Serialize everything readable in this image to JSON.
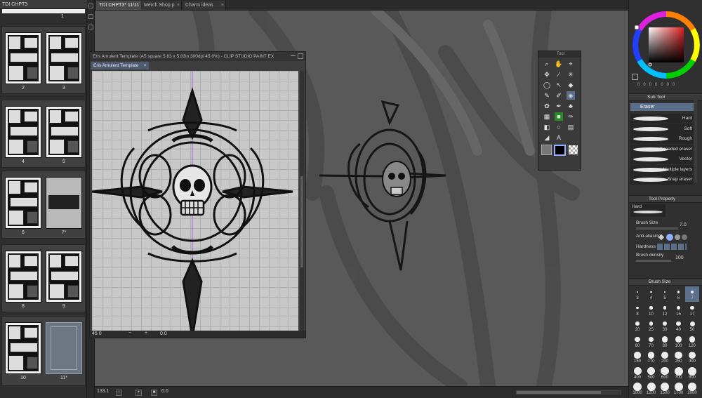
{
  "left_panel": {
    "tab_label": "TDI CHPT3",
    "top_page_num": "1",
    "pages": [
      {
        "label": "2",
        "type": "manga"
      },
      {
        "label": "3",
        "type": "manga"
      },
      {
        "label": "4",
        "type": "manga"
      },
      {
        "label": "5",
        "type": "manga"
      },
      {
        "label": "6",
        "type": "manga"
      },
      {
        "label": "7*",
        "type": "gray"
      },
      {
        "label": "8",
        "type": "manga"
      },
      {
        "label": "9",
        "type": "manga"
      },
      {
        "label": "10",
        "type": "manga"
      },
      {
        "label": "11*",
        "type": "blank"
      }
    ]
  },
  "tabs": [
    {
      "label": "TDI CHPT3* 11/11",
      "active": true
    },
    {
      "label": "Merch Shop p",
      "active": false
    },
    {
      "label": "Charm ideas",
      "active": false
    }
  ],
  "sub_window": {
    "title": "Eris Amulent Template (A5 square 5.83 x 5.83in 300dpi 45.0%) - CLIP STUDIO PAINT EX",
    "tab_label": "Eris Amulent Template",
    "zoom": "45.0",
    "rotation": "0.0"
  },
  "status_bar": {
    "zoom": "133.1",
    "rotation": "0.0"
  },
  "tool_palette": {
    "title": "Tool"
  },
  "right_panel": {
    "sub_tool_header": "Sub Tool",
    "active_subtool": "Eraser",
    "brushes": [
      "Hard",
      "Soft",
      "Rough",
      "Kneaded eraser",
      "Vector",
      "Multiple layers",
      "Snap eraser"
    ],
    "tool_property_header": "Tool Property",
    "preset_label": "Hard",
    "brush_size_label": "Brush Size",
    "brush_size_value": "7.0",
    "anti_aliasing_label": "Anti-aliasing",
    "hardness_label": "Hardness",
    "brush_density_label": "Brush density",
    "brush_density_value": "100",
    "brush_size_panel_header": "Brush Size",
    "size_presets": [
      "3",
      "4",
      "5",
      "6",
      "7",
      "8",
      "10",
      "12",
      "15",
      "17",
      "20",
      "25",
      "30",
      "40",
      "50",
      "60",
      "70",
      "80",
      "100",
      "120",
      "150",
      "170",
      "200",
      "250",
      "300",
      "400",
      "500",
      "600",
      "700",
      "800",
      "1000",
      "1200",
      "1500",
      "1700",
      "2000"
    ],
    "selected_size": "7",
    "main_color": "#d62020",
    "sub_color": "#ffffff"
  }
}
